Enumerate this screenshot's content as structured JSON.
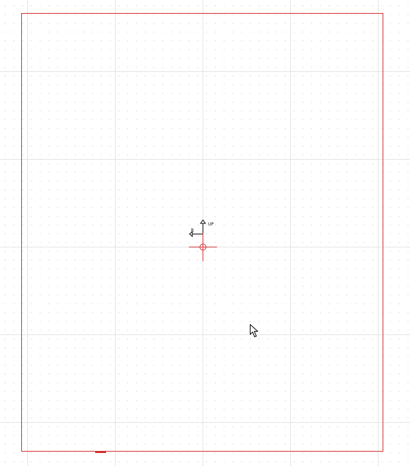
{
  "app": {
    "view": "drawing-canvas"
  },
  "colors": {
    "sheet_border": "#d42a2a",
    "origin_marker": "#d42a2a",
    "grid_major": "#e3e3e3",
    "grid_dot": "#c8c8c8",
    "ucs_icon": "#000000",
    "background": "#ffffff"
  },
  "ucs": {
    "x_axis_label": "R",
    "y_axis_label": "UP"
  },
  "icons": {
    "origin": "crosshair-origin-icon",
    "ucs": "ucs-axes-icon",
    "cursor": "mouse-pointer-icon"
  }
}
